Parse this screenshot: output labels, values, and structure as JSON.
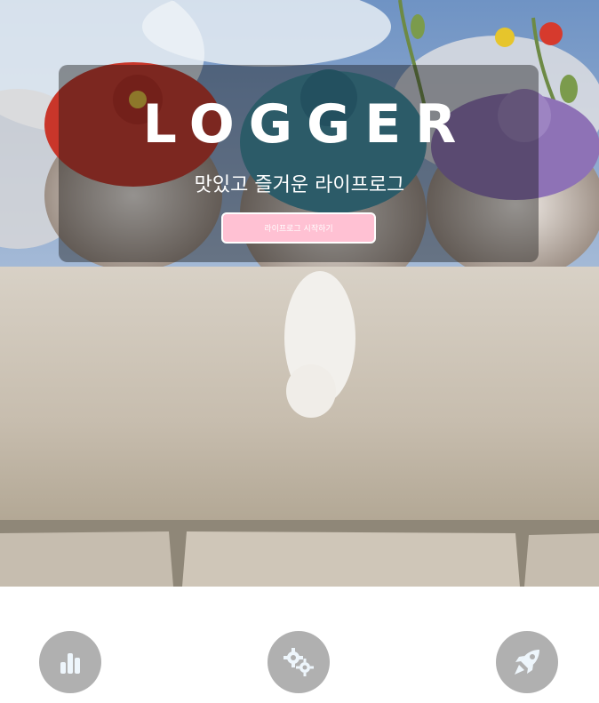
{
  "hero": {
    "title": "LOGGER",
    "subtitle": "맛있고 즐거운 라이프로그",
    "cta_label": "라이프로그 시작하기"
  },
  "features": [
    {
      "icon": "bar-chart-icon"
    },
    {
      "icon": "gears-icon"
    },
    {
      "icon": "rocket-icon"
    }
  ],
  "colors": {
    "overlay": "rgba(20,20,20,0.42)",
    "cta_background": "#ffc1d3",
    "feature_circle": "#b0b0b0",
    "icon_fill": "#eef6fc"
  }
}
